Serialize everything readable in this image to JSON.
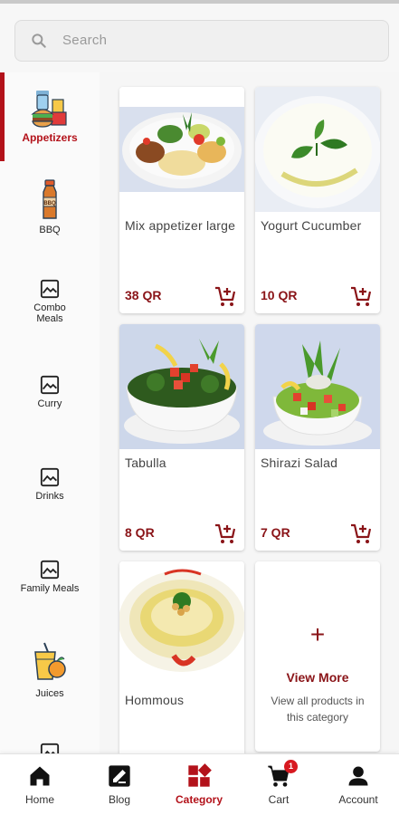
{
  "search": {
    "placeholder": "Search",
    "icon": "search-icon"
  },
  "sidebar": {
    "items": [
      {
        "label": "Appetizers",
        "icon": "appetizers-icon",
        "active": true
      },
      {
        "label": "BBQ",
        "icon": "bbq-sauce-icon"
      },
      {
        "label": "Combo Meals",
        "icon": "image-placeholder-icon"
      },
      {
        "label": "Curry",
        "icon": "image-placeholder-icon"
      },
      {
        "label": "Drinks",
        "icon": "image-placeholder-icon"
      },
      {
        "label": "Family Meals",
        "icon": "image-placeholder-icon"
      },
      {
        "label": "Juices",
        "icon": "juice-icon"
      }
    ]
  },
  "products": [
    {
      "name": "Mix appetizer large",
      "price": "38 QR"
    },
    {
      "name": "Yogurt Cucumber",
      "price": "10 QR"
    },
    {
      "name": "Tabulla",
      "price": "8 QR"
    },
    {
      "name": "Shirazi Salad",
      "price": "7 QR"
    },
    {
      "name": "Hommous",
      "price": ""
    }
  ],
  "view_more": {
    "plus": "+",
    "title": "View More",
    "description": "View all products in this category"
  },
  "bottom_nav": {
    "items": [
      {
        "label": "Home",
        "icon": "home-icon"
      },
      {
        "label": "Blog",
        "icon": "blog-edit-icon"
      },
      {
        "label": "Category",
        "icon": "category-icon",
        "active": true
      },
      {
        "label": "Cart",
        "icon": "cart-icon",
        "badge": "1"
      },
      {
        "label": "Account",
        "icon": "account-icon"
      }
    ]
  },
  "colors": {
    "accent": "#b3121a",
    "price": "#8a1418",
    "badge": "#d71920"
  }
}
